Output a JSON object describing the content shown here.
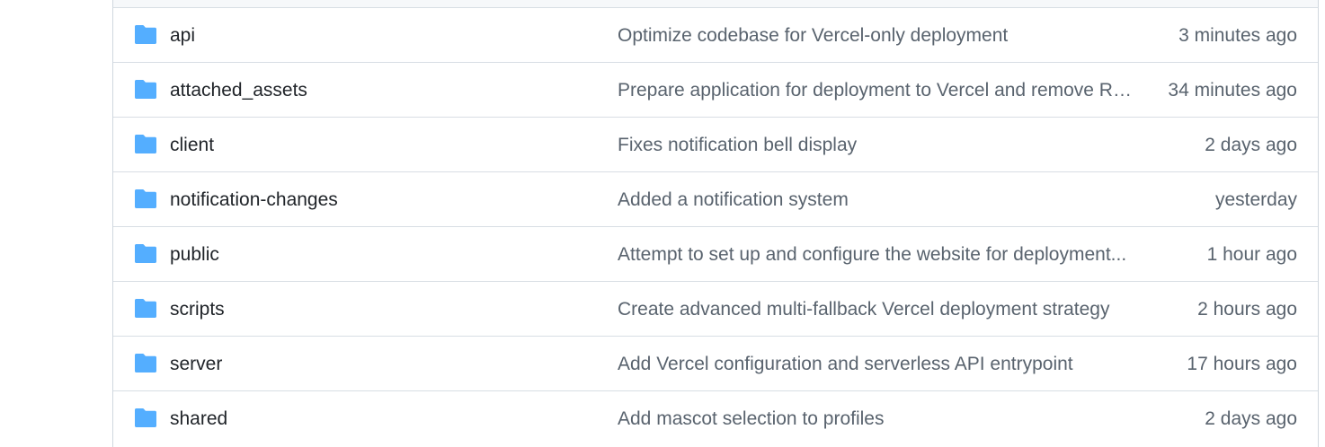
{
  "colors": {
    "folder_icon": "#54aeff",
    "name_text": "#1f2328",
    "muted_text": "#59636e",
    "border": "#d8dee4"
  },
  "files": [
    {
      "icon": "folder-icon",
      "name": "api",
      "commit": "Optimize codebase for Vercel-only deployment",
      "age": "3 minutes ago"
    },
    {
      "icon": "folder-icon",
      "name": "attached_assets",
      "commit": "Prepare application for deployment to Vercel and remove Re...",
      "age": "34 minutes ago"
    },
    {
      "icon": "folder-icon",
      "name": "client",
      "commit": "Fixes notification bell display",
      "age": "2 days ago"
    },
    {
      "icon": "folder-icon",
      "name": "notification-changes",
      "commit": "Added a notification system",
      "age": "yesterday"
    },
    {
      "icon": "folder-icon",
      "name": "public",
      "commit": "Attempt to set up and configure the website for deployment...",
      "age": "1 hour ago"
    },
    {
      "icon": "folder-icon",
      "name": "scripts",
      "commit": "Create advanced multi-fallback Vercel deployment strategy",
      "age": "2 hours ago"
    },
    {
      "icon": "folder-icon",
      "name": "server",
      "commit": "Add Vercel configuration and serverless API entrypoint",
      "age": "17 hours ago"
    },
    {
      "icon": "folder-icon",
      "name": "shared",
      "commit": "Add mascot selection to profiles",
      "age": "2 days ago"
    }
  ]
}
